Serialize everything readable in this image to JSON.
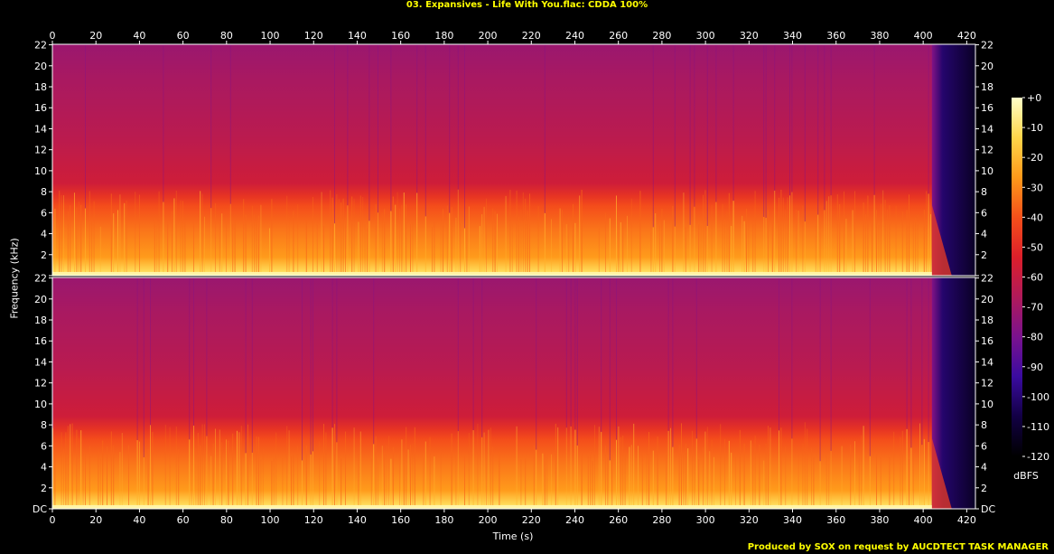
{
  "title": "03. Expansives - Life With You.flac: CDDA 100%",
  "credit": "Produced by SOX on request by AUCDTECT TASK MANAGER",
  "chart_data": {
    "type": "heatmap",
    "title": "03. Expansives - Life With You.flac: CDDA 100%",
    "xlabel": "Time (s)",
    "ylabel": "Frequency (kHz)",
    "xlim": [
      0,
      424
    ],
    "ylim": [
      0,
      22.05
    ],
    "x_ticks": [
      "0",
      "20",
      "40",
      "60",
      "80",
      "100",
      "120",
      "140",
      "160",
      "180",
      "200",
      "220",
      "240",
      "260",
      "280",
      "300",
      "320",
      "340",
      "360",
      "380",
      "400",
      "420"
    ],
    "y_ticks": [
      "DC",
      "2",
      "4",
      "6",
      "8",
      "10",
      "12",
      "14",
      "16",
      "18",
      "20",
      "22"
    ],
    "channels": 2,
    "colorbar": {
      "label": "dBFS",
      "range": [
        -120,
        0
      ],
      "ticks": [
        "+0",
        "-10",
        "-20",
        "-30",
        "-40",
        "-50",
        "-60",
        "-70",
        "-80",
        "-90",
        "-100",
        "-110",
        "-120"
      ]
    },
    "audio_end_s": 404,
    "energy_band_khz": 7.5,
    "colors": {
      "background": "#000000",
      "title": "#ffff00",
      "axis": "#ffffff",
      "scale": [
        "#000000",
        "#120044",
        "#3a0ba0",
        "#7a128e",
        "#b01a5a",
        "#dc1f2a",
        "#f5501a",
        "#ff9a1a",
        "#ffd64a",
        "#ffffc8"
      ]
    }
  }
}
